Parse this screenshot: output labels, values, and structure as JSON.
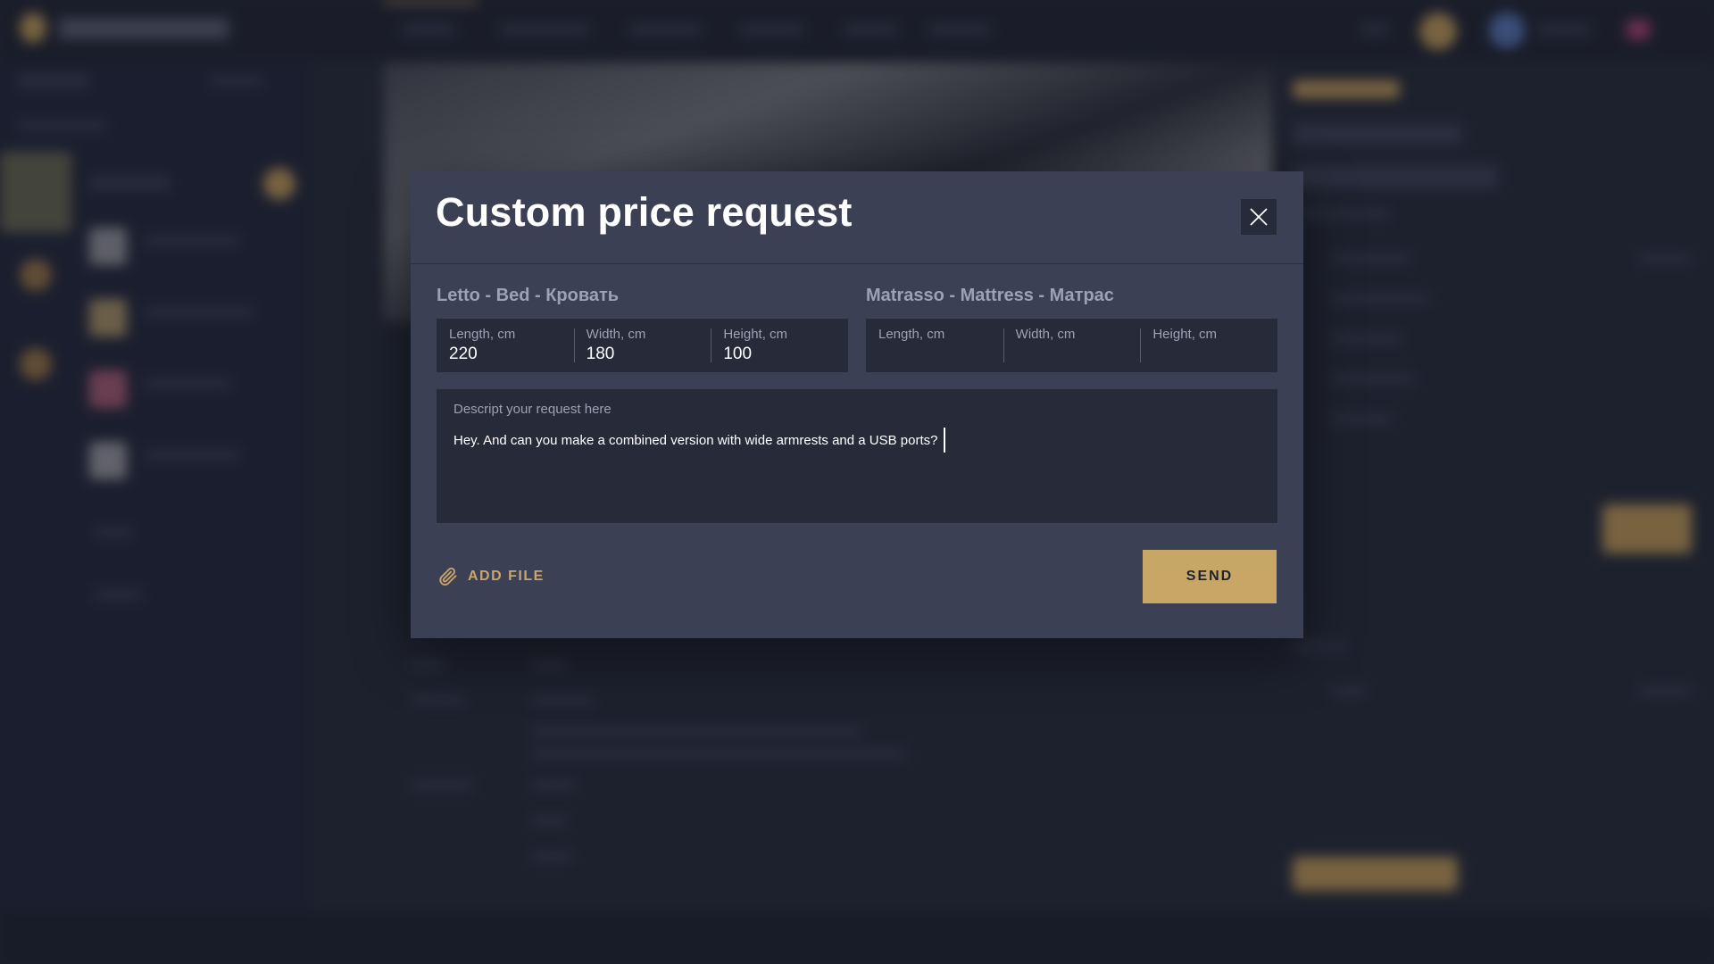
{
  "modal": {
    "title": "Custom price request",
    "bed": {
      "title": "Letto - Bed - Кровать",
      "length_label": "Length, cm",
      "length_value": "220",
      "width_label": "Width, cm",
      "width_value": "180",
      "height_label": "Height, cm",
      "height_value": "100"
    },
    "mattress": {
      "title": "Matrasso - Mattress - Матрас",
      "length_label": "Length, cm",
      "length_value": "",
      "width_label": "Width, cm",
      "width_value": "",
      "height_label": "Height, cm",
      "height_value": ""
    },
    "request": {
      "label": "Descript your request here",
      "value": "Hey. And can you make a combined version with wide armrests and a USB ports?"
    },
    "add_file_label": "ADD FILE",
    "send_label": "SEND"
  },
  "colors": {
    "accent": "#c8a665",
    "modal_bg": "#3b4054",
    "field_bg": "#262a39"
  },
  "icons": [
    "close-icon",
    "paperclip-icon"
  ]
}
